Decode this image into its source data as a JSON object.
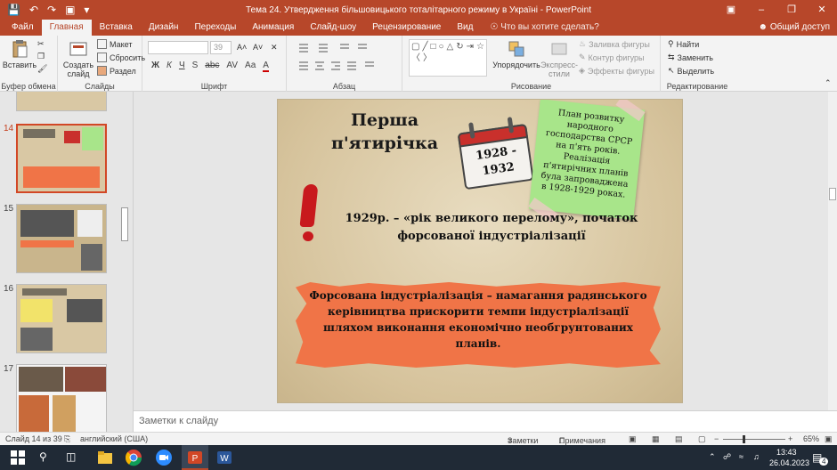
{
  "window": {
    "title": "Тема 24. Утвердження більшовицького тоталітарного режиму в Україні - PowerPoint",
    "buttons": [
      "▣",
      "–",
      "❐",
      "✕"
    ]
  },
  "tabs": [
    "Файл",
    "Главная",
    "Вставка",
    "Дизайн",
    "Переходы",
    "Анимация",
    "Слайд-шоу",
    "Рецензирование",
    "Вид"
  ],
  "active_tab": "Главная",
  "tell_me": "Что вы хотите сделать?",
  "share": "Общий доступ",
  "ribbon": {
    "clipboard": {
      "paste": "Вставить",
      "label": "Буфер обмена"
    },
    "slides": {
      "new_slide": "Создать слайд",
      "layout": "Макет",
      "reset": "Сбросить",
      "section": "Раздел",
      "label": "Слайды"
    },
    "font": {
      "font_name": "",
      "font_size": "39",
      "format_buttons": [
        "Ж",
        "К",
        "Ч",
        "S",
        "abc",
        "AV",
        "Aa",
        "A"
      ],
      "label": "Шрифт"
    },
    "paragraph": {
      "label": "Абзац"
    },
    "drawing": {
      "arrange": "Упорядочить",
      "styles": "Экспресс-стили",
      "fill": "Заливка фигуры",
      "outline": "Контур фигуры",
      "effects": "Эффекты фигуры",
      "label": "Рисование"
    },
    "editing": {
      "find": "Найти",
      "replace": "Заменить",
      "select": "Выделить",
      "label": "Редактирование"
    }
  },
  "thumbnails": [
    {
      "num": "14",
      "selected": true
    },
    {
      "num": "15",
      "selected": false
    },
    {
      "num": "16",
      "selected": false
    },
    {
      "num": "17",
      "selected": false
    }
  ],
  "slide": {
    "title": "Перша п'ятирічка",
    "calendar": "1928 - 1932",
    "note": "План розвитку народного господарства СРСР на п'ять років. Реалізація п'ятирічних планів була запроваджена в 1928-1929 роках.",
    "line1": "1929р. – «рік великого перелому», початок форсованої індустріалізації",
    "definition": "Форсована індустріалізація – намагання радянського керівництва прискорити темпи індустріалізації шляхом виконання економічно необгрунтованих планів."
  },
  "notes_placeholder": "Заметки к слайду",
  "status": {
    "slide_of": "Слайд 14 из 39",
    "language": "английский (США)",
    "notes": "Заметки",
    "comments": "Примечания",
    "zoom": "65%"
  },
  "taskbar": {
    "time": "13:43",
    "date": "26.04.2023",
    "notification_count": "4"
  },
  "colors": {
    "accent": "#b7472a",
    "slide_bg": "#dccba8",
    "torn_paper": "#f07447",
    "sticky_note": "#a8e58a",
    "exclamation": "#c8191d"
  }
}
